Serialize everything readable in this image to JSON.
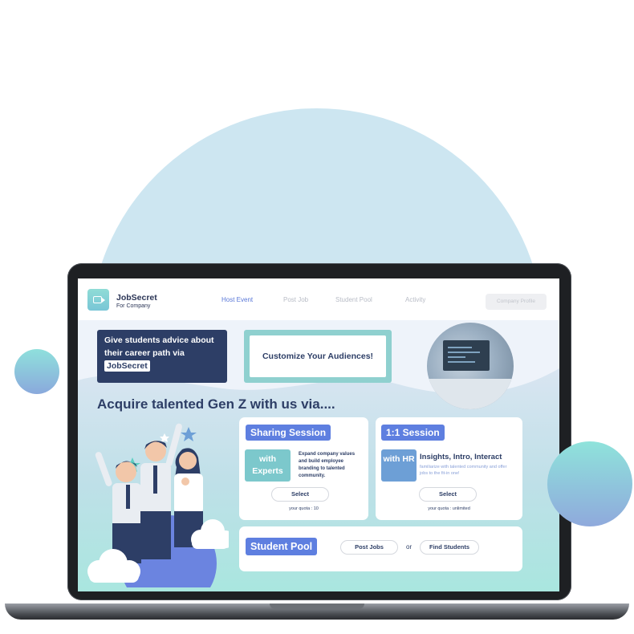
{
  "nav": {
    "brand": "JobSecret",
    "brand_sub": "For Company",
    "items": [
      {
        "label": "Host Event",
        "active": true
      },
      {
        "label": "Post Job",
        "active": false
      },
      {
        "label": "Student Pool",
        "active": false
      },
      {
        "label": "Activity",
        "active": false
      }
    ],
    "profile_button": "Company Profile"
  },
  "hero": {
    "advice_text": "Give students advice about their career path via",
    "advice_chip": "JobSecret",
    "customize_button": "Customize Your Audiences!",
    "headline": "Acquire talented Gen Z with us via...."
  },
  "sharing_session": {
    "title": "Sharing Session",
    "badge": "with Experts",
    "description": "Expand company values and build employee branding to talented community.",
    "select_label": "Select",
    "quota": "your quota : 10"
  },
  "one_on_one": {
    "title": "1:1 Session",
    "badge": "with HR",
    "heading": "Insights, Intro, Interact",
    "description": "familiarize with talented community and offer jobs to the fit-in one!",
    "select_label": "Select",
    "quota": "your quota : unlimited"
  },
  "student_pool": {
    "title": "Student Pool",
    "post_jobs": "Post Jobs",
    "or": "or",
    "find_students": "Find Students"
  },
  "colors": {
    "navy": "#2d3e66",
    "accent_blue": "#5e7fe0",
    "teal": "#7cc8cc",
    "nav_active": "#5a78d8"
  }
}
